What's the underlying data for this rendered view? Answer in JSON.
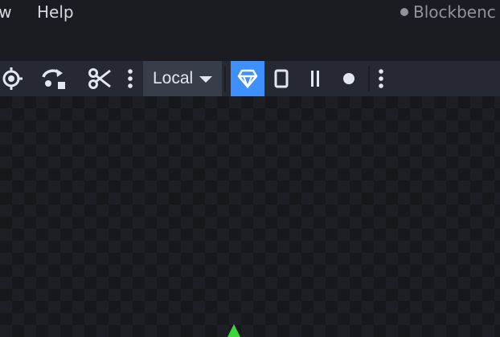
{
  "menubar": {
    "items": [
      "ew",
      "Help"
    ]
  },
  "app": {
    "title": "Blockbenc"
  },
  "toolbar": {
    "tools": [
      {
        "name": "pivot-tool",
        "icon": "crosshair-icon"
      },
      {
        "name": "rotate-tool",
        "icon": "rotate-icon"
      },
      {
        "name": "cut-tool",
        "icon": "scissors-icon"
      }
    ],
    "space_select": {
      "value": "Local"
    },
    "modes": [
      {
        "name": "mode-gem",
        "icon": "gem-icon",
        "active": true
      },
      {
        "name": "mode-rect",
        "icon": "rectangle-icon",
        "active": false
      },
      {
        "name": "mode-lines",
        "icon": "vertical-bars-icon",
        "active": false
      },
      {
        "name": "mode-dot",
        "icon": "dot-icon",
        "active": false
      }
    ]
  },
  "colors": {
    "accent": "#3e90ff",
    "toolbar_bg": "#262932",
    "viewport_bg": "#17181c",
    "gizmo_y": "#3ad63a"
  }
}
